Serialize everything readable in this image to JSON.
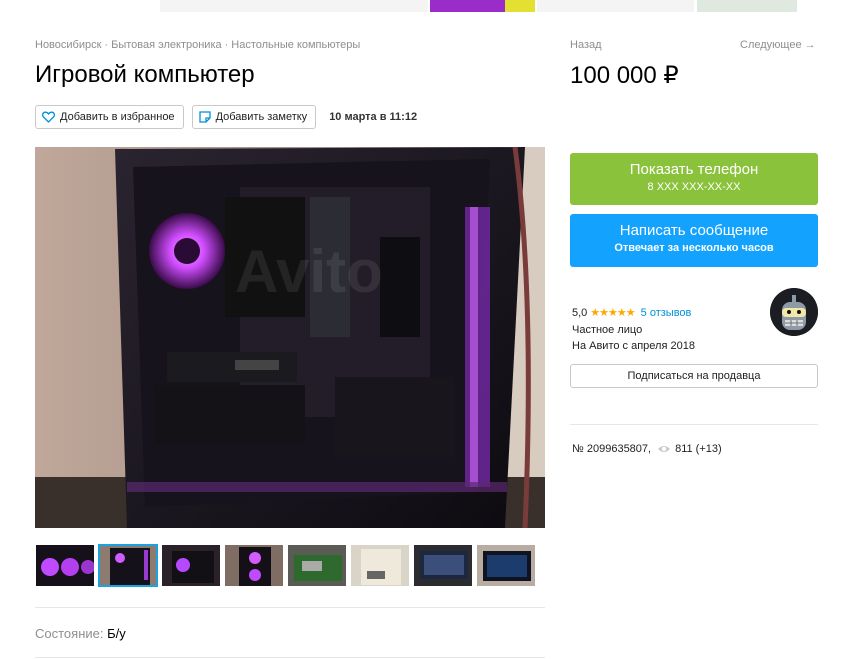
{
  "breadcrumbs": [
    "Новосибирск",
    "Бытовая электроника",
    "Настольные компьютеры"
  ],
  "title": "Игровой компьютер",
  "actions": {
    "favorite_label": "Добавить в избранное",
    "note_label": "Добавить заметку",
    "date": "10 марта в 11:12"
  },
  "nav": {
    "back": "Назад",
    "next": "Следующее →"
  },
  "price": "100 000 ₽",
  "phone_button": {
    "label": "Показать телефон",
    "sub": "8 XXX XXX-XX-XX"
  },
  "message_button": {
    "label": "Написать сообщение",
    "sub": "Отвечает за несколько часов"
  },
  "seller": {
    "rating": "5,0",
    "stars": "★★★★★",
    "reviews": "5 отзывов",
    "type": "Частное лицо",
    "since": "На Авито с апреля 2018",
    "subscribe_label": "Подписаться на продавца"
  },
  "stats": {
    "item_number": "№ 2099635807,",
    "views": "811 (+13)"
  },
  "condition": {
    "label": "Состояние:",
    "value": "Б/у"
  },
  "thumbnails": [
    {
      "name": "thumb-1"
    },
    {
      "name": "thumb-2"
    },
    {
      "name": "thumb-3"
    },
    {
      "name": "thumb-4"
    },
    {
      "name": "thumb-5"
    },
    {
      "name": "thumb-6"
    },
    {
      "name": "thumb-7"
    },
    {
      "name": "thumb-8"
    }
  ],
  "colors": {
    "green": "#8ac33b",
    "blue": "#13a3ff",
    "link": "#0091d9",
    "star": "#ffa800",
    "accent": "#b040ff"
  },
  "icons": [
    "heart-icon",
    "note-icon",
    "eye-icon",
    "avatar-icon"
  ]
}
